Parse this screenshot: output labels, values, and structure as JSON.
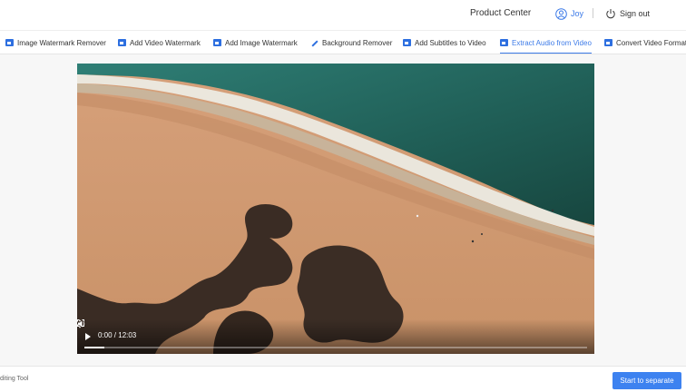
{
  "header": {
    "product_center": "Product Center",
    "user_name": "Joy",
    "sign_out": "Sign out"
  },
  "tabs": [
    {
      "label": "Image Watermark Remover",
      "icon": "image-icon",
      "active": false
    },
    {
      "label": "Add Video Watermark",
      "icon": "video-icon",
      "active": false
    },
    {
      "label": "Add Image Watermark",
      "icon": "image-icon",
      "active": false
    },
    {
      "label": "Background Remover",
      "icon": "magic-brush-icon",
      "active": false
    },
    {
      "label": "Add Subtitles to Video",
      "icon": "subtitles-icon",
      "active": false
    },
    {
      "label": "Extract Audio from Video",
      "icon": "audio-icon",
      "active": true
    },
    {
      "label": "Convert Video Format",
      "icon": "convert-icon",
      "active": false
    }
  ],
  "player": {
    "time": "0:00 / 12:03",
    "progress": 0.04
  },
  "footer": {
    "tool_label": "diting Tool",
    "start_button": "Start to separate"
  },
  "colors": {
    "accent": "#3d7be8",
    "button": "#3d82f0"
  }
}
